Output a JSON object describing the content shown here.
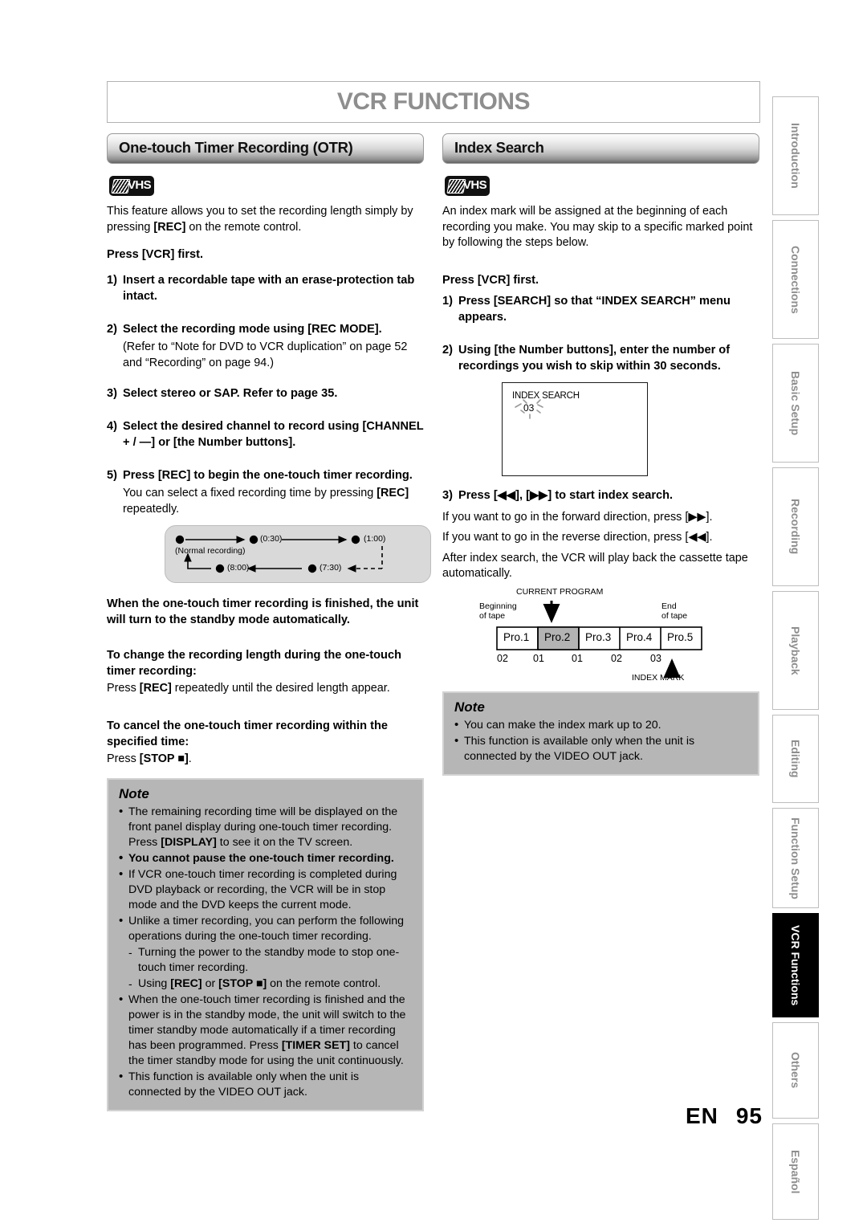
{
  "chapter": {
    "title": "VCR FUNCTIONS"
  },
  "footer": {
    "lang": "EN",
    "page": "95"
  },
  "tabs": [
    {
      "label": "Introduction",
      "active": false
    },
    {
      "label": "Connections",
      "active": false
    },
    {
      "label": "Basic Setup",
      "active": false
    },
    {
      "label": "Recording",
      "active": false
    },
    {
      "label": "Playback",
      "active": false
    },
    {
      "label": "Editing",
      "active": false
    },
    {
      "label": "Function Setup",
      "active": false
    },
    {
      "label": "VCR Functions",
      "active": true
    },
    {
      "label": "Others",
      "active": false
    },
    {
      "label": "Español",
      "active": false
    }
  ],
  "left": {
    "section_title": "One-touch Timer Recording (OTR)",
    "media_badge": "VHS",
    "intro": "This feature allows you to set the recording length simply by pressing [REC] on the remote control.",
    "intro_bold_token": "[REC]",
    "press_first": "Press [VCR] first.",
    "steps": [
      {
        "num": "1)",
        "text": "Insert a recordable tape with an erase-protection tab intact.",
        "sub": ""
      },
      {
        "num": "2)",
        "text": "Select the recording mode using [REC MODE].",
        "sub": "(Refer to “Note for DVD to VCR duplication” on page 52 and “Recording” on page 94.)"
      },
      {
        "num": "3)",
        "text": "Select stereo or SAP. Refer to page 35.",
        "sub": ""
      },
      {
        "num": "4)",
        "text": "Select the desired channel to record using [CHANNEL + / —] or [the Number buttons].",
        "sub": ""
      },
      {
        "num": "5)",
        "text": "Press [REC] to begin the one-touch timer recording.",
        "sub": "You can select a fixed recording time by pressing [REC] repeatedly."
      }
    ],
    "otr_diagram": {
      "nodes": [
        {
          "label": "(Normal recording)"
        },
        {
          "label": "(0:30)"
        },
        {
          "label": "(1:00)"
        },
        {
          "label": "(7:30)"
        },
        {
          "label": "(8:00)"
        }
      ]
    },
    "finish_note": "When the one-touch timer recording is finished, the unit will turn to the standby mode automatically.",
    "change_head": "To change the recording length during the one-touch timer recording:",
    "change_body": "Press [REC] repeatedly until the desired length appear.",
    "cancel_head": "To cancel the one-touch timer recording within the specified time:",
    "cancel_body": "Press [STOP ■].",
    "note": {
      "title": "Note",
      "items": [
        {
          "kind": "bullet",
          "strong": false,
          "text": "The remaining recording time will be displayed on the front panel display during one-touch timer recording. Press [DISPLAY] to see it on the TV screen."
        },
        {
          "kind": "bullet",
          "strong": true,
          "text": "You cannot pause the one-touch timer recording."
        },
        {
          "kind": "bullet",
          "strong": false,
          "text": "If VCR one-touch timer recording is completed during DVD playback or recording, the VCR will be in stop mode and the DVD keeps the current mode."
        },
        {
          "kind": "bullet",
          "strong": false,
          "text": "Unlike a timer recording, you can perform the following operations during the one-touch timer recording."
        },
        {
          "kind": "dash",
          "strong": false,
          "text": "Turning the power to the standby mode to stop one-touch timer recording."
        },
        {
          "kind": "dash",
          "strong": false,
          "text": "Using [REC] or [STOP ■] on the remote control."
        },
        {
          "kind": "bullet",
          "strong": false,
          "text": "When the one-touch timer recording is finished and the power is in the standby mode, the unit will switch to the timer standby mode automatically if a timer recording has been programmed. Press [TIMER SET] to cancel the timer standby mode for using the unit continuously."
        },
        {
          "kind": "bullet",
          "strong": false,
          "text": "This function is available only when the unit is connected by the VIDEO OUT jack."
        }
      ]
    }
  },
  "right": {
    "section_title": "Index Search",
    "media_badge": "VHS",
    "intro": "An index mark will be assigned at the beginning of each recording you make. You may skip to a specific marked point by following the steps below.",
    "press_first": "Press [VCR] first.",
    "steps": [
      {
        "num": "1)",
        "text": "Press [SEARCH] so that “INDEX SEARCH” menu appears.",
        "sub": ""
      },
      {
        "num": "2)",
        "text": "Using [the Number buttons], enter the number of recordings you wish to skip within 30 seconds.",
        "sub": ""
      },
      {
        "num": "3)",
        "text": "Press [◀◀], [▶▶] to start index search.",
        "sub": ""
      }
    ],
    "osd": {
      "title": "INDEX SEARCH",
      "value": "03"
    },
    "after_step3": [
      "If you want to go in the forward direction, press [▶▶].",
      "If you want to go in the reverse direction, press [◀◀].",
      "After index search, the VCR will play back the cassette tape automatically."
    ],
    "tape_diagram": {
      "current_program_label": "CURRENT PROGRAM",
      "beginning_label": "Beginning\nof tape",
      "end_label": "End\nof tape",
      "index_mark_label": "INDEX MARK",
      "programs": [
        "Pro.1",
        "Pro.2",
        "Pro.3",
        "Pro.4",
        "Pro.5"
      ],
      "current_index": 1,
      "marks": [
        "02",
        "01",
        "01",
        "02",
        "03"
      ]
    },
    "note": {
      "title": "Note",
      "items": [
        {
          "kind": "bullet",
          "strong": false,
          "text": "You can make the index mark up to 20."
        },
        {
          "kind": "bullet",
          "strong": false,
          "text": "This function is available only when the unit is connected by the VIDEO OUT jack."
        }
      ]
    }
  }
}
